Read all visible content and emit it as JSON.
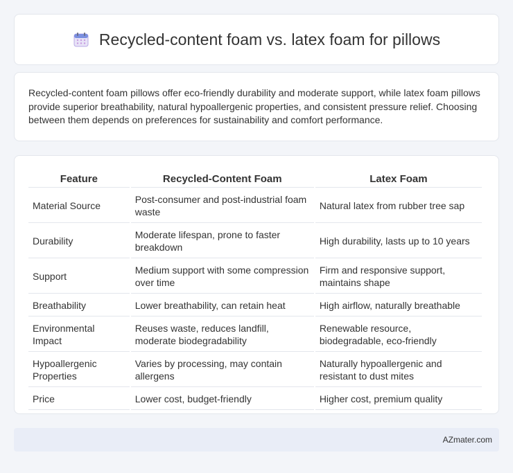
{
  "header": {
    "icon": "calendar-icon",
    "title": "Recycled-content foam vs. latex foam for pillows"
  },
  "summary": {
    "text": "Recycled-content foam pillows offer eco-friendly durability and moderate support, while latex foam pillows provide superior breathability, natural hypoallergenic properties, and consistent pressure relief. Choosing between them depends on preferences for sustainability and comfort performance."
  },
  "table": {
    "headers": [
      "Feature",
      "Recycled-Content Foam",
      "Latex Foam"
    ],
    "rows": [
      [
        "Material Source",
        "Post-consumer and post-industrial foam waste",
        "Natural latex from rubber tree sap"
      ],
      [
        "Durability",
        "Moderate lifespan, prone to faster breakdown",
        "High durability, lasts up to 10 years"
      ],
      [
        "Support",
        "Medium support with some compression over time",
        "Firm and responsive support, maintains shape"
      ],
      [
        "Breathability",
        "Lower breathability, can retain heat",
        "High airflow, naturally breathable"
      ],
      [
        "Environmental Impact",
        "Reuses waste, reduces landfill, moderate biodegradability",
        "Renewable resource, biodegradable, eco-friendly"
      ],
      [
        "Hypoallergenic Properties",
        "Varies by processing, may contain allergens",
        "Naturally hypoallergenic and resistant to dust mites"
      ],
      [
        "Price",
        "Lower cost, budget-friendly",
        "Higher cost, premium quality"
      ]
    ]
  },
  "footer": {
    "brand": "AZmater.com"
  }
}
